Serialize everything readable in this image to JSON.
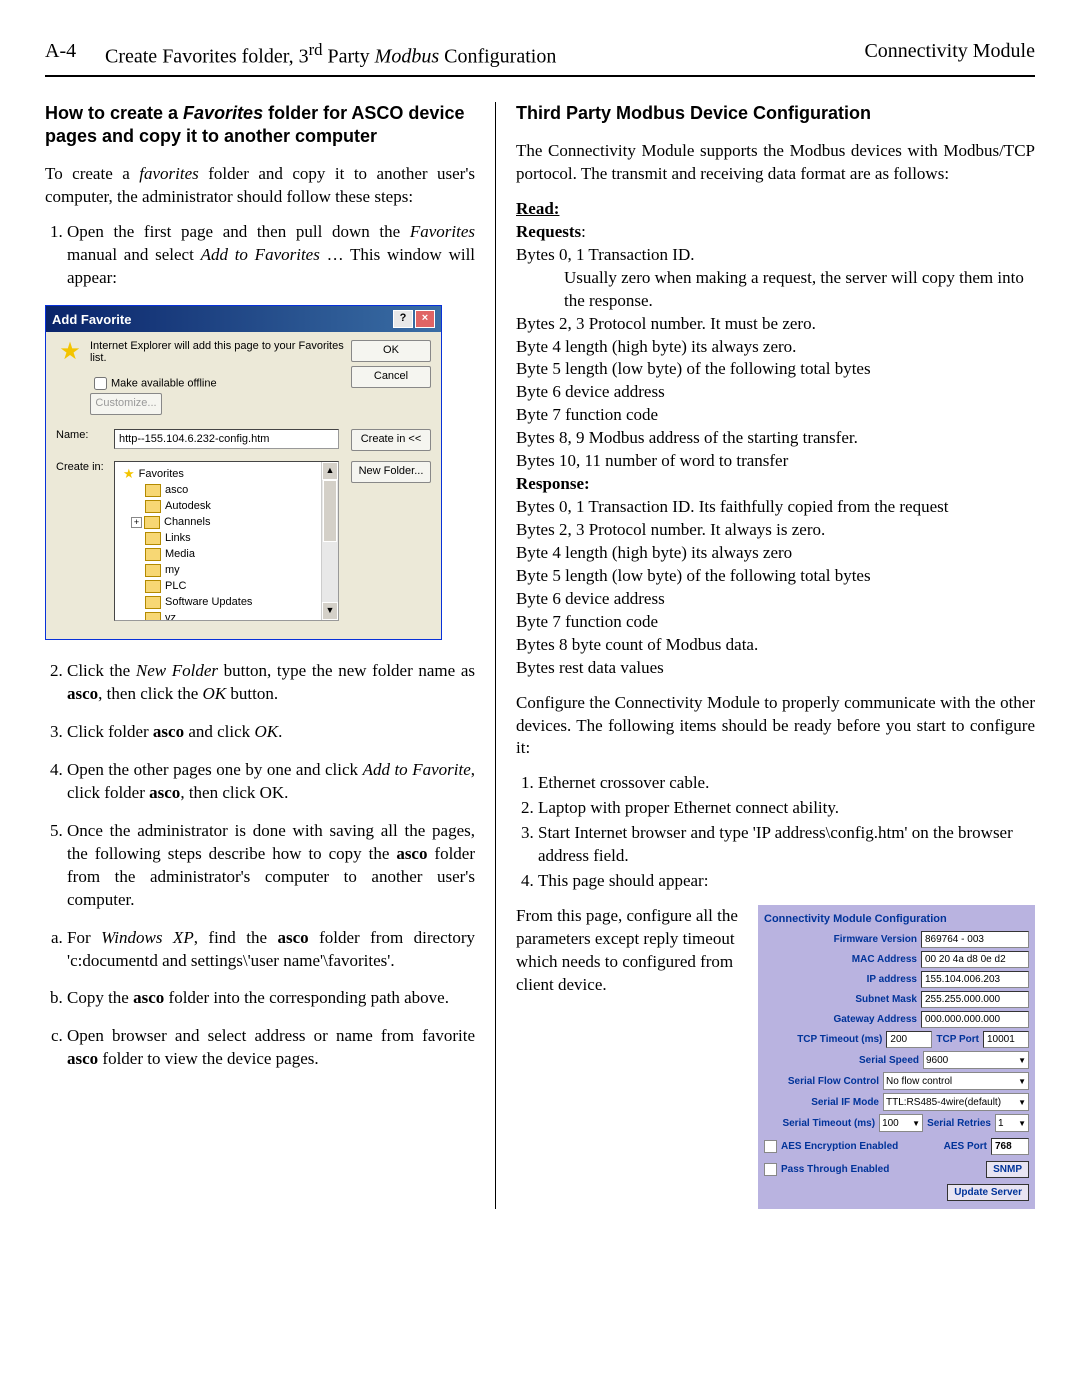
{
  "header": {
    "pageNum": "A-4",
    "center_pre": "Create Favorites folder, 3",
    "center_sup": "rd",
    "center_post": " Party ",
    "center_italic": "Modbus",
    "center_end": " Configuration",
    "right": "Connectivity Module"
  },
  "left": {
    "heading_pre": "How to create a ",
    "heading_em": "Favorites",
    "heading_post": " folder for ASCO device pages and copy it to another computer",
    "intro_pre": "To create a ",
    "intro_em": "favorites",
    "intro_post": " folder and copy it to another user's computer, the administrator should follow these steps:",
    "step1_a": "Open the first page and then pull down the ",
    "step1_em": "Favorites",
    "step1_b": " manual and select ",
    "step1_em2": "Add to Favorites",
    "step1_c": " … This window will appear:",
    "step2_a": "Click the ",
    "step2_em": "New Folder",
    "step2_b": " button, type the new folder name as ",
    "step2_bold": "asco",
    "step2_c": ", then click the ",
    "step2_em2": "OK",
    "step2_d": " button.",
    "step3_a": "Click folder ",
    "step3_bold": "asco",
    "step3_b": " and click ",
    "step3_em": "OK",
    "step3_c": ".",
    "step4_a": "Open the other pages one by one and click ",
    "step4_em": "Add to Favorite",
    "step4_b": ", click folder ",
    "step4_bold": "asco",
    "step4_c": ", then click OK.",
    "step5_a": "Once the administrator is done with saving all the pages, the following steps describe how to copy the ",
    "step5_bold": "asco",
    "step5_b": " folder from the administrator's computer to another user's computer.",
    "sub_a_a": "For ",
    "sub_a_em": "Windows XP",
    "sub_a_b": ", find the ",
    "sub_a_bold": "asco",
    "sub_a_c": " folder from directory 'c:documentd and settings\\'user name'\\favorites'.",
    "sub_b_a": "Copy the ",
    "sub_b_bold": "asco",
    "sub_b_b": " folder into the corresponding path above.",
    "sub_c_a": "Open browser and select address or name from favorite ",
    "sub_c_bold": "asco",
    "sub_c_b": " folder to view the device pages."
  },
  "dialog": {
    "title": "Add Favorite",
    "msg": "Internet Explorer will add this page to your Favorites list.",
    "offline": "Make available offline",
    "customize": "Customize...",
    "ok": "OK",
    "cancel": "Cancel",
    "nameLbl": "Name:",
    "nameVal": "http--155.104.6.232-config.htm",
    "createInBtn": "Create in <<",
    "createInLbl": "Create in:",
    "newFolder": "New Folder...",
    "tree": [
      "Favorites",
      "asco",
      "Autodesk",
      "Channels",
      "Links",
      "Media",
      "my",
      "PLC",
      "Software Updates",
      "vz"
    ]
  },
  "right": {
    "heading": "Third Party Modbus Device Configuration",
    "intro": "The Connectivity Module supports the Modbus devices with Modbus/TCP portocol. The transmit and receiving data format are as follows:",
    "readLbl": "Read:",
    "requestsLbl": "Requests",
    "req": [
      "Bytes 0, 1 Transaction ID.",
      "Usually zero when making a request, the server will copy them into the response.",
      "Bytes 2, 3 Protocol number. It must be zero.",
      "Byte 4 length (high byte) its always zero.",
      "Byte 5 length (low byte) of the following total bytes",
      "Byte 6 device address",
      "Byte 7 function code",
      "Bytes 8, 9 Modbus address of the starting transfer.",
      "Bytes 10, 11 number of word to transfer"
    ],
    "responseLbl": "Response:",
    "resp": [
      "Bytes 0, 1 Transaction ID. Its faithfully copied from the request",
      "Bytes 2, 3 Protocol number. It always is zero.",
      "Byte 4 length (high byte)  its always zero",
      "Byte 5 length (low byte) of the following total bytes",
      "Byte 6 device address",
      "Byte 7 function code",
      "Bytes 8 byte count of Modbus data.",
      "Bytes rest data values"
    ],
    "cfgIntro": "Configure the Connectivity Module to properly communicate with the other devices. The following items should be ready before you start to configure it:",
    "cfgList": [
      "Ethernet crossover cable.",
      "Laptop with proper Ethernet connect ability.",
      "Start Internet browser and type 'IP address\\config.htm' on the browser address field.",
      "This page should appear:"
    ],
    "sideText": "From this page, configure all the parameters except reply timeout which needs to configured from client device."
  },
  "cfg": {
    "title": "Connectivity Module Configuration",
    "fw_l": "Firmware Version",
    "fw_v": "869764 - 003",
    "mac_l": "MAC Address",
    "mac_v": "00 20 4a d8 0e d2",
    "ip_l": "IP address",
    "ip_v": "155.104.006.203",
    "sm_l": "Subnet Mask",
    "sm_v": "255.255.000.000",
    "gw_l": "Gateway Address",
    "gw_v": "000.000.000.000",
    "tto_l": "TCP Timeout (ms)",
    "tto_v": "200",
    "tport_l": "TCP Port",
    "tport_v": "10001",
    "ss_l": "Serial Speed",
    "ss_v": "9600",
    "sfc_l": "Serial Flow Control",
    "sfc_v": "No flow control",
    "sif_l": "Serial IF Mode",
    "sif_v": "TTL:RS485-4wire(default)",
    "sto_l": "Serial Timeout (ms)",
    "sto_v": "100",
    "sr_l": "Serial Retries",
    "sr_v": "1",
    "aes_l": "AES Encryption Enabled",
    "aesport_l": "AES Port",
    "aesport_v": "768",
    "pt_l": "Pass Through Enabled",
    "snmp": "SNMP",
    "update": "Update Server"
  }
}
